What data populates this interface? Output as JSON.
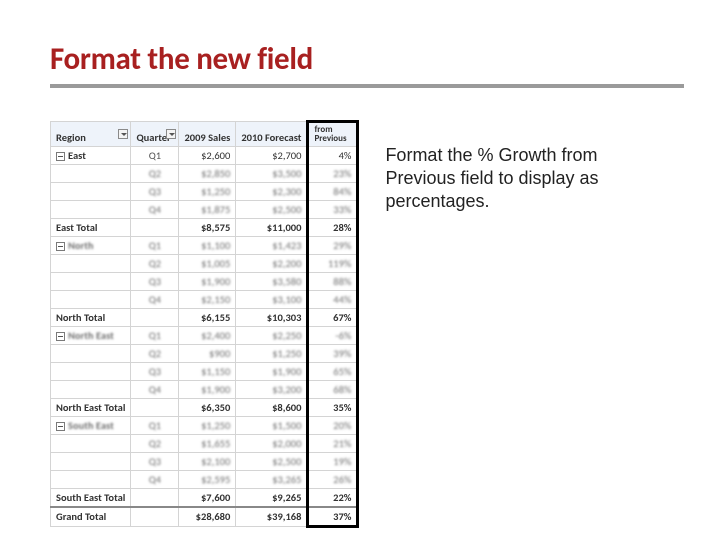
{
  "title": "Format the new field",
  "caption": "Format the % Growth from Previous field to display as percentages.",
  "headers": {
    "region": "Region",
    "quarter": "Quarter",
    "sales": "2009 Sales",
    "forecast": "2010 Forecast",
    "growth_line1": "from",
    "growth_line2": "Previous"
  },
  "groups": [
    {
      "name": "East",
      "rows": [
        {
          "q": "Q1",
          "sales": "$2,600",
          "forecast": "$2,700",
          "growth": "4%",
          "blur": false
        },
        {
          "q": "Q2",
          "sales": "$2,850",
          "forecast": "$3,500",
          "growth": "23%",
          "blur": true
        },
        {
          "q": "Q3",
          "sales": "$1,250",
          "forecast": "$2,300",
          "growth": "84%",
          "blur": true
        },
        {
          "q": "Q4",
          "sales": "$1,875",
          "forecast": "$2,500",
          "growth": "33%",
          "blur": true
        }
      ],
      "total": {
        "label": "East Total",
        "sales": "$8,575",
        "forecast": "$11,000",
        "growth": "28%"
      }
    },
    {
      "name": "North",
      "rows": [
        {
          "q": "Q1",
          "sales": "$1,100",
          "forecast": "$1,423",
          "growth": "29%",
          "blur": true
        },
        {
          "q": "Q2",
          "sales": "$1,005",
          "forecast": "$2,200",
          "growth": "119%",
          "blur": true
        },
        {
          "q": "Q3",
          "sales": "$1,900",
          "forecast": "$3,580",
          "growth": "88%",
          "blur": true
        },
        {
          "q": "Q4",
          "sales": "$2,150",
          "forecast": "$3,100",
          "growth": "44%",
          "blur": true
        }
      ],
      "total": {
        "label": "North Total",
        "sales": "$6,155",
        "forecast": "$10,303",
        "growth": "67%"
      }
    },
    {
      "name": "North East",
      "rows": [
        {
          "q": "Q1",
          "sales": "$2,400",
          "forecast": "$2,250",
          "growth": "-6%",
          "blur": true
        },
        {
          "q": "Q2",
          "sales": "$900",
          "forecast": "$1,250",
          "growth": "39%",
          "blur": true
        },
        {
          "q": "Q3",
          "sales": "$1,150",
          "forecast": "$1,900",
          "growth": "65%",
          "blur": true
        },
        {
          "q": "Q4",
          "sales": "$1,900",
          "forecast": "$3,200",
          "growth": "68%",
          "blur": true
        }
      ],
      "total": {
        "label": "North East Total",
        "sales": "$6,350",
        "forecast": "$8,600",
        "growth": "35%"
      }
    },
    {
      "name": "South East",
      "rows": [
        {
          "q": "Q1",
          "sales": "$1,250",
          "forecast": "$1,500",
          "growth": "20%",
          "blur": true
        },
        {
          "q": "Q2",
          "sales": "$1,655",
          "forecast": "$2,000",
          "growth": "21%",
          "blur": true
        },
        {
          "q": "Q3",
          "sales": "$2,100",
          "forecast": "$2,500",
          "growth": "19%",
          "blur": true
        },
        {
          "q": "Q4",
          "sales": "$2,595",
          "forecast": "$3,265",
          "growth": "26%",
          "blur": true
        }
      ],
      "total": {
        "label": "South East Total",
        "sales": "$7,600",
        "forecast": "$9,265",
        "growth": "22%"
      }
    }
  ],
  "grand": {
    "label": "Grand Total",
    "sales": "$28,680",
    "forecast": "$39,168",
    "growth": "37%"
  }
}
